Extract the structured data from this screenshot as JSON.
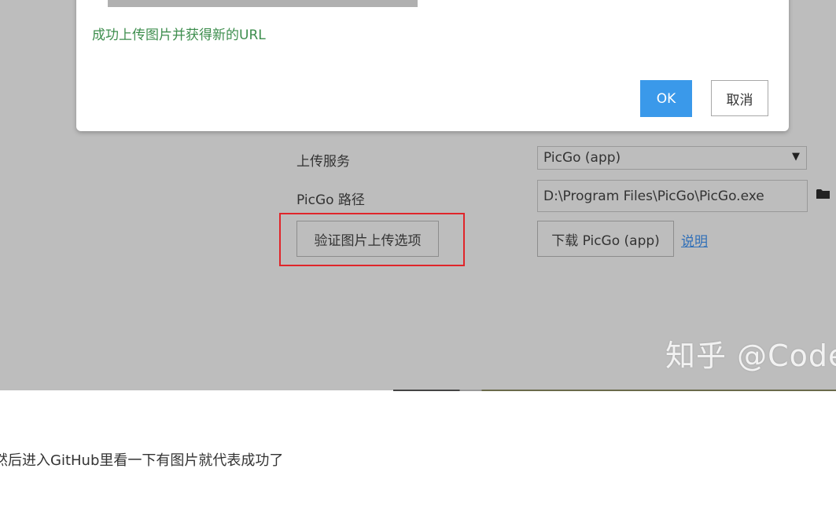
{
  "dialog": {
    "success_message": "成功上传图片并获得新的URL",
    "ok_label": "OK",
    "cancel_label": "取消"
  },
  "settings": {
    "upload_service_label": "上传服务",
    "upload_service_value": "PicGo (app)",
    "picgo_path_label": "PicGo 路径",
    "picgo_path_value": "D:\\Program Files\\PicGo\\PicGo.exe",
    "verify_button_label": "验证图片上传选项",
    "download_button_label": "下载 PicGo (app)",
    "help_link_label": "说明"
  },
  "watermark": "知乎 @CodeB",
  "article": {
    "text": "然后进入GitHub里看一下有图片就代表成功了"
  },
  "colors": {
    "primary": "#3a99ea",
    "success_text": "#3e8e4e",
    "highlight_box": "#e0252a",
    "link": "#2f6fb8"
  }
}
